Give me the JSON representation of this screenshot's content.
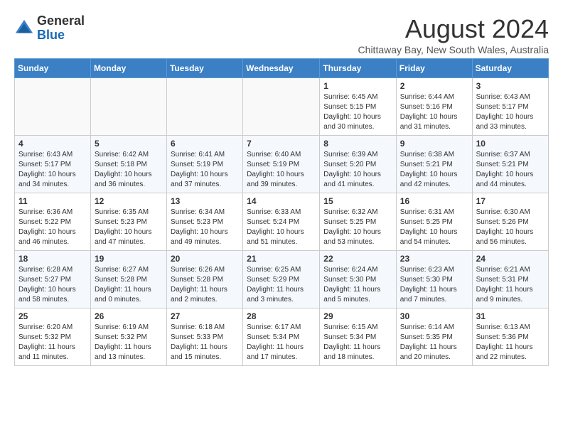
{
  "logo": {
    "general": "General",
    "blue": "Blue"
  },
  "header": {
    "month_year": "August 2024",
    "location": "Chittaway Bay, New South Wales, Australia"
  },
  "days_of_week": [
    "Sunday",
    "Monday",
    "Tuesday",
    "Wednesday",
    "Thursday",
    "Friday",
    "Saturday"
  ],
  "weeks": [
    [
      {
        "day": "",
        "info": ""
      },
      {
        "day": "",
        "info": ""
      },
      {
        "day": "",
        "info": ""
      },
      {
        "day": "",
        "info": ""
      },
      {
        "day": "1",
        "info": "Sunrise: 6:45 AM\nSunset: 5:15 PM\nDaylight: 10 hours\nand 30 minutes."
      },
      {
        "day": "2",
        "info": "Sunrise: 6:44 AM\nSunset: 5:16 PM\nDaylight: 10 hours\nand 31 minutes."
      },
      {
        "day": "3",
        "info": "Sunrise: 6:43 AM\nSunset: 5:17 PM\nDaylight: 10 hours\nand 33 minutes."
      }
    ],
    [
      {
        "day": "4",
        "info": "Sunrise: 6:43 AM\nSunset: 5:17 PM\nDaylight: 10 hours\nand 34 minutes."
      },
      {
        "day": "5",
        "info": "Sunrise: 6:42 AM\nSunset: 5:18 PM\nDaylight: 10 hours\nand 36 minutes."
      },
      {
        "day": "6",
        "info": "Sunrise: 6:41 AM\nSunset: 5:19 PM\nDaylight: 10 hours\nand 37 minutes."
      },
      {
        "day": "7",
        "info": "Sunrise: 6:40 AM\nSunset: 5:19 PM\nDaylight: 10 hours\nand 39 minutes."
      },
      {
        "day": "8",
        "info": "Sunrise: 6:39 AM\nSunset: 5:20 PM\nDaylight: 10 hours\nand 41 minutes."
      },
      {
        "day": "9",
        "info": "Sunrise: 6:38 AM\nSunset: 5:21 PM\nDaylight: 10 hours\nand 42 minutes."
      },
      {
        "day": "10",
        "info": "Sunrise: 6:37 AM\nSunset: 5:21 PM\nDaylight: 10 hours\nand 44 minutes."
      }
    ],
    [
      {
        "day": "11",
        "info": "Sunrise: 6:36 AM\nSunset: 5:22 PM\nDaylight: 10 hours\nand 46 minutes."
      },
      {
        "day": "12",
        "info": "Sunrise: 6:35 AM\nSunset: 5:23 PM\nDaylight: 10 hours\nand 47 minutes."
      },
      {
        "day": "13",
        "info": "Sunrise: 6:34 AM\nSunset: 5:23 PM\nDaylight: 10 hours\nand 49 minutes."
      },
      {
        "day": "14",
        "info": "Sunrise: 6:33 AM\nSunset: 5:24 PM\nDaylight: 10 hours\nand 51 minutes."
      },
      {
        "day": "15",
        "info": "Sunrise: 6:32 AM\nSunset: 5:25 PM\nDaylight: 10 hours\nand 53 minutes."
      },
      {
        "day": "16",
        "info": "Sunrise: 6:31 AM\nSunset: 5:25 PM\nDaylight: 10 hours\nand 54 minutes."
      },
      {
        "day": "17",
        "info": "Sunrise: 6:30 AM\nSunset: 5:26 PM\nDaylight: 10 hours\nand 56 minutes."
      }
    ],
    [
      {
        "day": "18",
        "info": "Sunrise: 6:28 AM\nSunset: 5:27 PM\nDaylight: 10 hours\nand 58 minutes."
      },
      {
        "day": "19",
        "info": "Sunrise: 6:27 AM\nSunset: 5:28 PM\nDaylight: 11 hours\nand 0 minutes."
      },
      {
        "day": "20",
        "info": "Sunrise: 6:26 AM\nSunset: 5:28 PM\nDaylight: 11 hours\nand 2 minutes."
      },
      {
        "day": "21",
        "info": "Sunrise: 6:25 AM\nSunset: 5:29 PM\nDaylight: 11 hours\nand 3 minutes."
      },
      {
        "day": "22",
        "info": "Sunrise: 6:24 AM\nSunset: 5:30 PM\nDaylight: 11 hours\nand 5 minutes."
      },
      {
        "day": "23",
        "info": "Sunrise: 6:23 AM\nSunset: 5:30 PM\nDaylight: 11 hours\nand 7 minutes."
      },
      {
        "day": "24",
        "info": "Sunrise: 6:21 AM\nSunset: 5:31 PM\nDaylight: 11 hours\nand 9 minutes."
      }
    ],
    [
      {
        "day": "25",
        "info": "Sunrise: 6:20 AM\nSunset: 5:32 PM\nDaylight: 11 hours\nand 11 minutes."
      },
      {
        "day": "26",
        "info": "Sunrise: 6:19 AM\nSunset: 5:32 PM\nDaylight: 11 hours\nand 13 minutes."
      },
      {
        "day": "27",
        "info": "Sunrise: 6:18 AM\nSunset: 5:33 PM\nDaylight: 11 hours\nand 15 minutes."
      },
      {
        "day": "28",
        "info": "Sunrise: 6:17 AM\nSunset: 5:34 PM\nDaylight: 11 hours\nand 17 minutes."
      },
      {
        "day": "29",
        "info": "Sunrise: 6:15 AM\nSunset: 5:34 PM\nDaylight: 11 hours\nand 18 minutes."
      },
      {
        "day": "30",
        "info": "Sunrise: 6:14 AM\nSunset: 5:35 PM\nDaylight: 11 hours\nand 20 minutes."
      },
      {
        "day": "31",
        "info": "Sunrise: 6:13 AM\nSunset: 5:36 PM\nDaylight: 11 hours\nand 22 minutes."
      }
    ]
  ]
}
